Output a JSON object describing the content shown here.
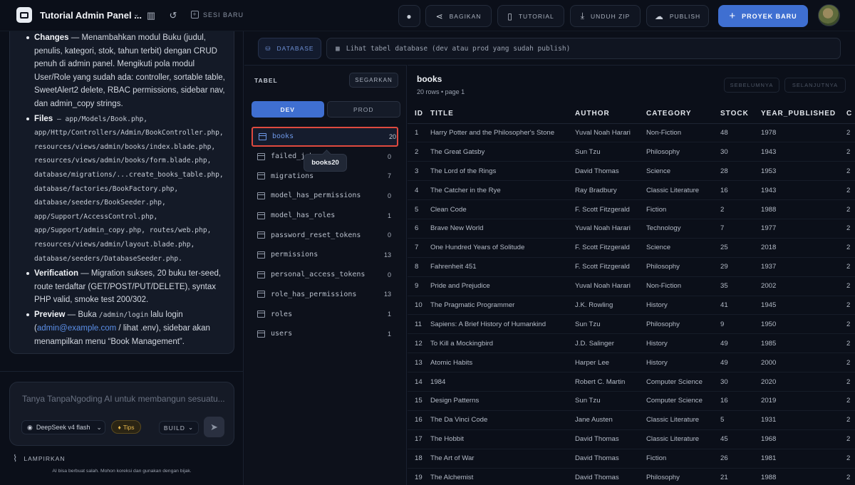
{
  "topbar": {
    "title": "Tutorial Admin Panel ...",
    "new_session": "SESI BARU",
    "share": "BAGIKAN",
    "tutorial": "TUTORIAL",
    "download": "UNDUH ZIP",
    "publish": "PUBLISH",
    "new_project": "PROYEK BARU"
  },
  "chat": {
    "items": [
      {
        "heading": "Changes",
        "text": " — Menambahkan modul Buku (judul, penulis, kategori, stok, tahun terbit) dengan CRUD penuh di admin panel. Mengikuti pola modul User/Role yang sudah ada: controller, sortable table, SweetAlert2 delete, RBAC permissions, sidebar nav, dan admin_copy strings."
      },
      {
        "heading": "Files",
        "text": " — app/Models/Book.php, app/Http/Controllers/Admin/BookController.php, resources/views/admin/books/index.blade.php, resources/views/admin/books/form.blade.php, database/migrations/...create_books_table.php, database/factories/BookFactory.php, database/seeders/BookSeeder.php, app/Support/AccessControl.php, app/Support/admin_copy.php, routes/web.php, resources/views/admin/layout.blade.php, database/seeders/DatabaseSeeder.php."
      },
      {
        "heading": "Verification",
        "text": " — Migration sukses, 20 buku ter-seed, route terdaftar (GET/POST/PUT/DELETE), syntax PHP valid, smoke test 200/302."
      },
      {
        "heading": "Preview",
        "text_before": " — Buka ",
        "code": "/admin/login",
        "text_mid": " lalu login (",
        "link": "admin@example.com",
        "text_after": " / lihat .env), sidebar akan menampilkan menu “Book Management”."
      }
    ],
    "composer_placeholder": "Tanya TanpaNgoding AI untuk membangun sesuatu...",
    "model": "DeepSeek v4 flash",
    "tips": "Tips",
    "mode": "BUILD",
    "attach": "LAMPIRKAN",
    "disclaimer": "AI bisa berbuat salah. Mohon koreksi dan gunakan dengan bijak."
  },
  "database": {
    "badge": "DATABASE",
    "info": "Lihat tabel database (dev atau prod yang sudah publish)",
    "panel_title": "TABEL",
    "refresh": "SEGARKAN",
    "env_tabs": [
      "DEV",
      "PROD"
    ],
    "active_env": "DEV",
    "tables": [
      {
        "name": "books",
        "count": "20",
        "selected": true
      },
      {
        "name": "failed_jobs",
        "count": "0"
      },
      {
        "name": "migrations",
        "count": "7"
      },
      {
        "name": "model_has_permissions",
        "count": "0"
      },
      {
        "name": "model_has_roles",
        "count": "1"
      },
      {
        "name": "password_reset_tokens",
        "count": "0"
      },
      {
        "name": "permissions",
        "count": "13"
      },
      {
        "name": "personal_access_tokens",
        "count": "0"
      },
      {
        "name": "role_has_permissions",
        "count": "13"
      },
      {
        "name": "roles",
        "count": "1"
      },
      {
        "name": "users",
        "count": "1"
      }
    ],
    "tooltip": "books20"
  },
  "grid": {
    "title": "books",
    "subtitle": "20 rows • page 1",
    "prev": "SEBELUMNYA",
    "next": "SELANJUTNYA",
    "columns": [
      "ID",
      "TITLE",
      "AUTHOR",
      "CATEGORY",
      "STOCK",
      "YEAR_PUBLISHED",
      "C"
    ],
    "rows": [
      [
        "1",
        "Harry Potter and the Philosopher's Stone",
        "Yuval Noah Harari",
        "Non-Fiction",
        "48",
        "1978",
        "2"
      ],
      [
        "2",
        "The Great Gatsby",
        "Sun Tzu",
        "Philosophy",
        "30",
        "1943",
        "2"
      ],
      [
        "3",
        "The Lord of the Rings",
        "David Thomas",
        "Science",
        "28",
        "1953",
        "2"
      ],
      [
        "4",
        "The Catcher in the Rye",
        "Ray Bradbury",
        "Classic Literature",
        "16",
        "1943",
        "2"
      ],
      [
        "5",
        "Clean Code",
        "F. Scott Fitzgerald",
        "Fiction",
        "2",
        "1988",
        "2"
      ],
      [
        "6",
        "Brave New World",
        "Yuval Noah Harari",
        "Technology",
        "7",
        "1977",
        "2"
      ],
      [
        "7",
        "One Hundred Years of Solitude",
        "F. Scott Fitzgerald",
        "Science",
        "25",
        "2018",
        "2"
      ],
      [
        "8",
        "Fahrenheit 451",
        "F. Scott Fitzgerald",
        "Philosophy",
        "29",
        "1937",
        "2"
      ],
      [
        "9",
        "Pride and Prejudice",
        "Yuval Noah Harari",
        "Non-Fiction",
        "35",
        "2002",
        "2"
      ],
      [
        "10",
        "The Pragmatic Programmer",
        "J.K. Rowling",
        "History",
        "41",
        "1945",
        "2"
      ],
      [
        "11",
        "Sapiens: A Brief History of Humankind",
        "Sun Tzu",
        "Philosophy",
        "9",
        "1950",
        "2"
      ],
      [
        "12",
        "To Kill a Mockingbird",
        "J.D. Salinger",
        "History",
        "49",
        "1985",
        "2"
      ],
      [
        "13",
        "Atomic Habits",
        "Harper Lee",
        "History",
        "49",
        "2000",
        "2"
      ],
      [
        "14",
        "1984",
        "Robert C. Martin",
        "Computer Science",
        "30",
        "2020",
        "2"
      ],
      [
        "15",
        "Design Patterns",
        "Sun Tzu",
        "Computer Science",
        "16",
        "2019",
        "2"
      ],
      [
        "16",
        "The Da Vinci Code",
        "Jane Austen",
        "Classic Literature",
        "5",
        "1931",
        "2"
      ],
      [
        "17",
        "The Hobbit",
        "David Thomas",
        "Classic Literature",
        "45",
        "1968",
        "2"
      ],
      [
        "18",
        "The Art of War",
        "David Thomas",
        "Fiction",
        "26",
        "1981",
        "2"
      ],
      [
        "19",
        "The Alchemist",
        "David Thomas",
        "Philosophy",
        "21",
        "1988",
        "2"
      ]
    ]
  }
}
